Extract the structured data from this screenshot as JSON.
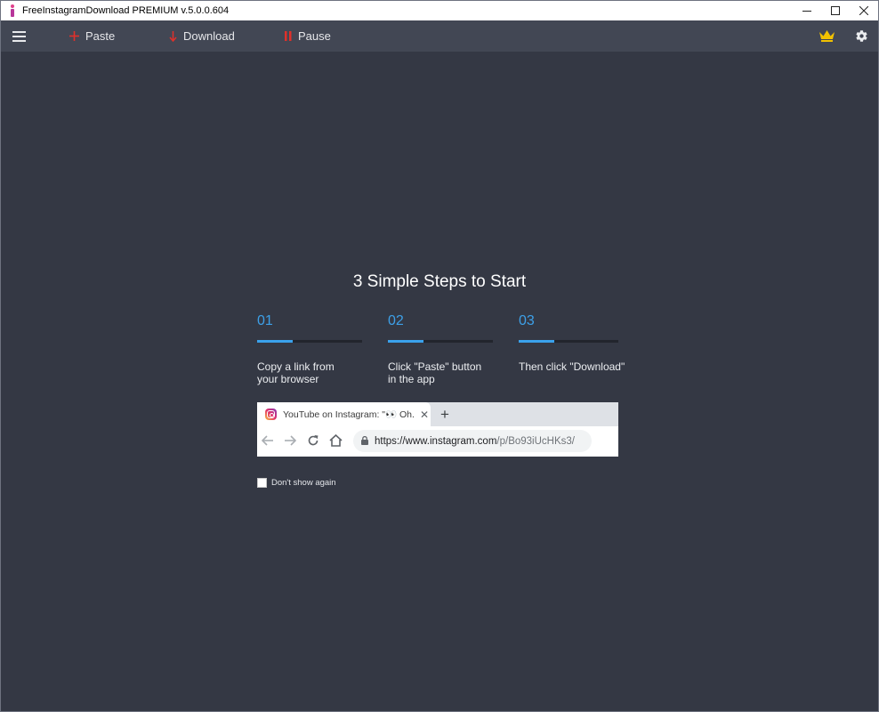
{
  "window": {
    "title": "FreeInstagramDownload PREMIUM  v.5.0.0.604"
  },
  "toolbar": {
    "paste_label": "Paste",
    "download_label": "Download",
    "pause_label": "Pause",
    "accent_color": "#e0302a",
    "premium_icon": "crown-icon",
    "settings_icon": "gear-icon"
  },
  "intro": {
    "heading": "3 Simple Steps to Start",
    "steps": [
      {
        "number": "01",
        "line1": "Copy a link from",
        "line2": "your browser"
      },
      {
        "number": "02",
        "line1": "Click \"Paste\" button",
        "line2": "in the app"
      },
      {
        "number": "03",
        "line1": "Then click \"Download\"",
        "line2": ""
      }
    ],
    "step_color": "#3da0e8"
  },
  "browser_example": {
    "tab_title": "YouTube on Instagram: \"👀 Oh. M",
    "url_main": "https://www.instagram.com",
    "url_path": "/p/Bo93iUcHKs3/"
  },
  "dont_show": {
    "label": "Don't show again",
    "checked": false
  }
}
